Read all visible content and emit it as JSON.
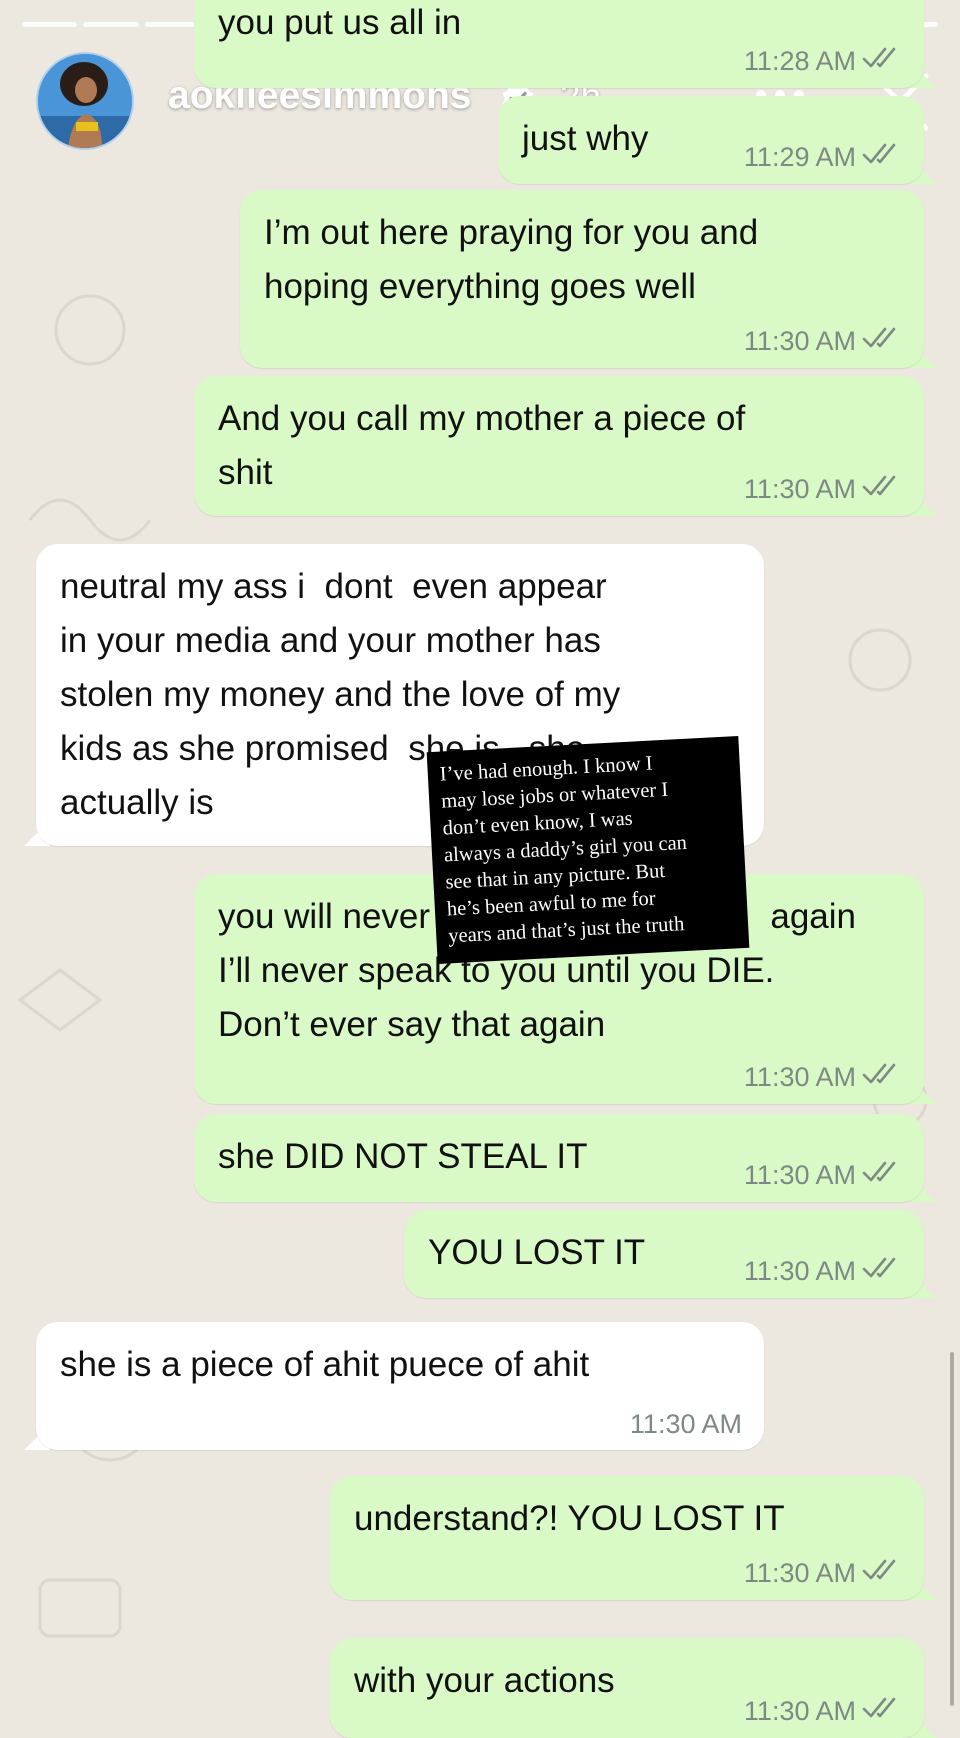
{
  "story": {
    "username": "aokileesimmons",
    "verified": true,
    "time_ago": "2h",
    "more_label": "•••",
    "close_label": "close",
    "segments": 15,
    "caption": "I’ve had enough. I know I\nmay lose jobs or whatever I\ndon’t even know, I was\nalways a daddy’s girl you can\nsee that in any picture. But\nhe’s been awful to me for\nyears and that’s just the truth"
  },
  "chat": {
    "messages": [
      {
        "direction": "out",
        "text": "you put us all in",
        "time": "11:28 AM",
        "read": true
      },
      {
        "direction": "out",
        "text": "just why",
        "time": "11:29 AM",
        "read": true
      },
      {
        "direction": "out",
        "text": "I’m out here praying for you and\nhoping everything goes well",
        "time": "11:30 AM",
        "read": true
      },
      {
        "direction": "out",
        "text": "And you call my mother a piece of\nshit",
        "time": "11:30 AM",
        "read": true
      },
      {
        "direction": "in",
        "text": "neutral my ass i  dont  even appear\nin your media and your mother has\nstolen my money and the love of my\nkids as she promised  she is   she\nactually is",
        "time": "",
        "read": false
      },
      {
        "direction": "out",
        "text": "you will never                                   again\nI’ll never speak to you until you DIE.\nDon’t ever say that again",
        "time": "11:30 AM",
        "read": true
      },
      {
        "direction": "out",
        "text": "she DID NOT STEAL IT",
        "time": "11:30 AM",
        "read": true
      },
      {
        "direction": "out",
        "text": "YOU LOST IT",
        "time": "11:30 AM",
        "read": true
      },
      {
        "direction": "in",
        "text": "she is a piece of ahit puece of ahit",
        "time": "11:30 AM",
        "read": false
      },
      {
        "direction": "out",
        "text": "understand?! YOU LOST IT",
        "time": "11:30 AM",
        "read": true
      },
      {
        "direction": "out",
        "text": "with your actions",
        "time": "11:30 AM",
        "read": true
      }
    ]
  },
  "colors": {
    "background": "#ece7df",
    "outgoing_bubble": "#d9f9c7",
    "incoming_bubble": "#ffffff",
    "timestamp": "#7d8a83",
    "read_tick": "#7d8a83"
  }
}
